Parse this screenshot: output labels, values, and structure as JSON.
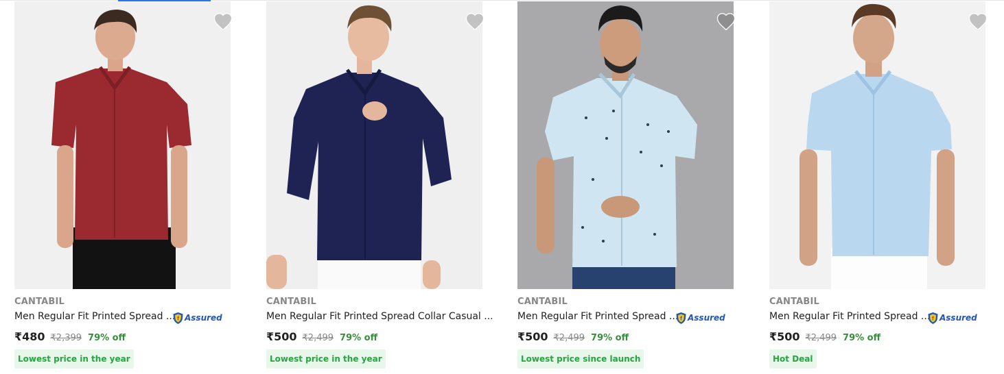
{
  "products": [
    {
      "brand": "CANTABIL",
      "title": "Men Regular Fit Printed Spread ...",
      "assured": "Assured",
      "price": "₹480",
      "mrp": "₹2,399",
      "discount": "79% off",
      "tag": "Lowest price in the year",
      "shirt_color": "#9a2a2f",
      "wishlist_icon": "heart-icon"
    },
    {
      "brand": "CANTABIL",
      "title": "Men Regular Fit Printed Spread Collar Casual ...",
      "assured": "",
      "price": "₹500",
      "mrp": "₹2,499",
      "discount": "79% off",
      "tag": "Lowest price in the year",
      "shirt_color": "#1e2354",
      "wishlist_icon": "heart-icon"
    },
    {
      "brand": "CANTABIL",
      "title": "Men Regular Fit Printed Spread ...",
      "assured": "Assured",
      "price": "₹500",
      "mrp": "₹2,499",
      "discount": "79% off",
      "tag": "Lowest price since launch",
      "shirt_color": "#cfe6f2",
      "wishlist_icon": "heart-icon"
    },
    {
      "brand": "CANTABIL",
      "title": "Men Regular Fit Printed Spread ...",
      "assured": "Assured",
      "price": "₹500",
      "mrp": "₹2,499",
      "discount": "79% off",
      "tag": "Hot Deal",
      "shirt_color": "#b9d8f0",
      "wishlist_icon": "heart-icon"
    }
  ],
  "colors": {
    "accent": "#2874f0",
    "discount_green": "#388e3c",
    "tag_bg": "#e7f8ea",
    "tag_text": "#26a541",
    "assured_blue": "#2455b8"
  }
}
